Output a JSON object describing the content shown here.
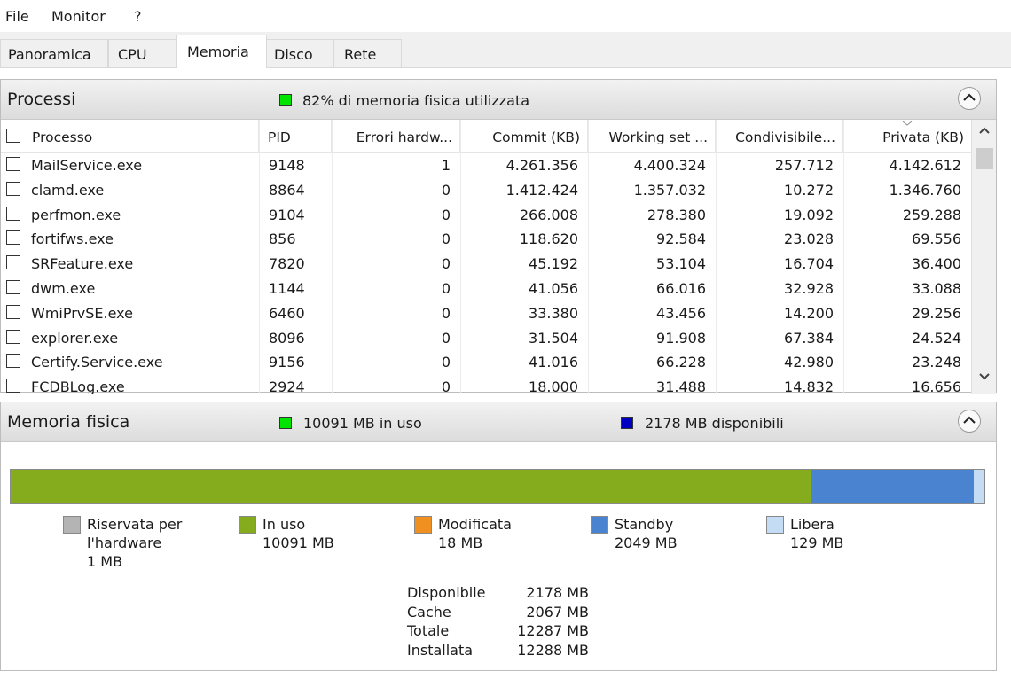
{
  "menu": [
    "File",
    "Monitor",
    "?"
  ],
  "tabs": [
    "Panoramica",
    "CPU",
    "Memoria",
    "Disco",
    "Rete"
  ],
  "active_tab": "Memoria",
  "processes": {
    "title": "Processi",
    "status_text": "82% di memoria fisica utilizzata",
    "status_color": "#00e400",
    "columns": [
      "Processo",
      "PID",
      "Errori hardw...",
      "Commit (KB)",
      "Working set ...",
      "Condivisibile...",
      "Privata (KB)"
    ],
    "sorted_column": "Privata (KB)",
    "rows": [
      {
        "name": "MailService.exe",
        "pid": "9148",
        "faults": "1",
        "commit": "4.261.356",
        "working": "4.400.324",
        "shareable": "257.712",
        "private": "4.142.612"
      },
      {
        "name": "clamd.exe",
        "pid": "8864",
        "faults": "0",
        "commit": "1.412.424",
        "working": "1.357.032",
        "shareable": "10.272",
        "private": "1.346.760"
      },
      {
        "name": "perfmon.exe",
        "pid": "9104",
        "faults": "0",
        "commit": "266.008",
        "working": "278.380",
        "shareable": "19.092",
        "private": "259.288"
      },
      {
        "name": "fortifws.exe",
        "pid": "856",
        "faults": "0",
        "commit": "118.620",
        "working": "92.584",
        "shareable": "23.028",
        "private": "69.556"
      },
      {
        "name": "SRFeature.exe",
        "pid": "7820",
        "faults": "0",
        "commit": "45.192",
        "working": "53.104",
        "shareable": "16.704",
        "private": "36.400"
      },
      {
        "name": "dwm.exe",
        "pid": "1144",
        "faults": "0",
        "commit": "41.056",
        "working": "66.016",
        "shareable": "32.928",
        "private": "33.088"
      },
      {
        "name": "WmiPrvSE.exe",
        "pid": "6460",
        "faults": "0",
        "commit": "33.380",
        "working": "43.456",
        "shareable": "14.200",
        "private": "29.256"
      },
      {
        "name": "explorer.exe",
        "pid": "8096",
        "faults": "0",
        "commit": "31.504",
        "working": "91.908",
        "shareable": "67.384",
        "private": "24.524"
      },
      {
        "name": "Certify.Service.exe",
        "pid": "9156",
        "faults": "0",
        "commit": "41.016",
        "working": "66.228",
        "shareable": "42.980",
        "private": "23.248"
      },
      {
        "name": "FCDBLog.exe",
        "pid": "2924",
        "faults": "0",
        "commit": "18.000",
        "working": "31.488",
        "shareable": "14.832",
        "private": "16.656"
      }
    ]
  },
  "physical": {
    "title": "Memoria fisica",
    "in_use_text": "10091 MB in uso",
    "available_text": "2178 MB disponibili",
    "in_use_color": "#00e400",
    "available_color": "#0000c0",
    "bar": {
      "total_mb": 12288,
      "segments": [
        {
          "name": "Riservata per l'hardware",
          "mb": 1,
          "color": "#b4b4b4"
        },
        {
          "name": "In uso",
          "mb": 10091,
          "color": "#84ac1c"
        },
        {
          "name": "Modificata",
          "mb": 18,
          "color": "#f09020"
        },
        {
          "name": "Standby",
          "mb": 2049,
          "color": "#4a84d0"
        },
        {
          "name": "Libera",
          "mb": 129,
          "color": "#c4dcf4"
        }
      ]
    },
    "legend": [
      {
        "line1": "Riservata per",
        "line2": "l'hardware",
        "line3": "1 MB",
        "color": "#b4b4b4"
      },
      {
        "line1": "In uso",
        "line2": "10091 MB",
        "line3": "",
        "color": "#84ac1c"
      },
      {
        "line1": "Modificata",
        "line2": "18 MB",
        "line3": "",
        "color": "#f09020"
      },
      {
        "line1": "Standby",
        "line2": "2049 MB",
        "line3": "",
        "color": "#4a84d0"
      },
      {
        "line1": "Libera",
        "line2": "129 MB",
        "line3": "",
        "color": "#c4dcf4"
      }
    ],
    "stats": [
      {
        "label": "Disponibile",
        "value": "2178 MB"
      },
      {
        "label": "Cache",
        "value": "2067 MB"
      },
      {
        "label": "Totale",
        "value": "12287 MB"
      },
      {
        "label": "Installata",
        "value": "12288 MB"
      }
    ]
  }
}
